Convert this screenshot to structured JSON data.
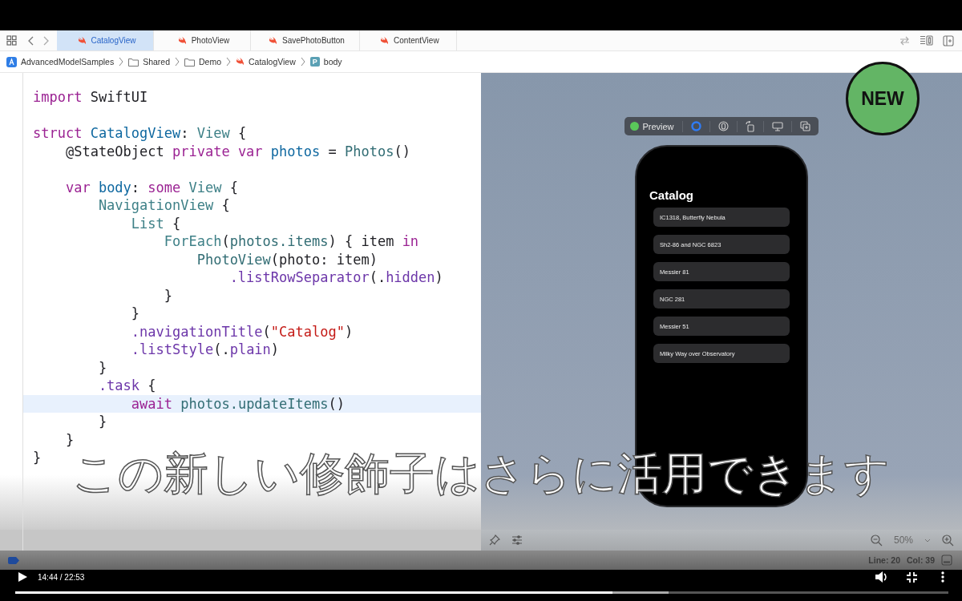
{
  "tabs": [
    {
      "label": "CatalogView",
      "selected": true
    },
    {
      "label": "PhotoView",
      "selected": false
    },
    {
      "label": "SavePhotoButton",
      "selected": false
    },
    {
      "label": "ContentView",
      "selected": false
    }
  ],
  "breadcrumb": [
    {
      "kind": "app",
      "label": "AdvancedModelSamples"
    },
    {
      "kind": "folder",
      "label": "Shared"
    },
    {
      "kind": "folder",
      "label": "Demo"
    },
    {
      "kind": "swift",
      "label": "CatalogView"
    },
    {
      "kind": "property",
      "badge": "P",
      "label": "body"
    }
  ],
  "code_lines": [
    {
      "kind": "code",
      "current": false,
      "tokens": [
        {
          "text": "import ",
          "kind": "kw"
        },
        {
          "text": "SwiftUI",
          "kind": "plain"
        }
      ]
    },
    {
      "kind": "blank"
    },
    {
      "kind": "code",
      "current": false,
      "tokens": [
        {
          "text": "struct ",
          "kind": "kw"
        },
        {
          "text": "CatalogView",
          "kind": "decl"
        },
        {
          "text": ": ",
          "kind": "plain"
        },
        {
          "text": "View",
          "kind": "type"
        },
        {
          "text": " {",
          "kind": "plain"
        }
      ]
    },
    {
      "kind": "code",
      "current": false,
      "tokens": [
        {
          "text": "    @StateObject ",
          "kind": "plain"
        },
        {
          "text": "private var ",
          "kind": "kw"
        },
        {
          "text": "photos",
          "kind": "decl"
        },
        {
          "text": " = ",
          "kind": "plain"
        },
        {
          "text": "Photos",
          "kind": "proj"
        },
        {
          "text": "()",
          "kind": "plain"
        }
      ]
    },
    {
      "kind": "blank"
    },
    {
      "kind": "code",
      "current": false,
      "tokens": [
        {
          "text": "    var ",
          "kind": "kw"
        },
        {
          "text": "body",
          "kind": "decl"
        },
        {
          "text": ": ",
          "kind": "plain"
        },
        {
          "text": "some ",
          "kind": "kw"
        },
        {
          "text": "View",
          "kind": "type"
        },
        {
          "text": " {",
          "kind": "plain"
        }
      ]
    },
    {
      "kind": "code",
      "current": false,
      "tokens": [
        {
          "text": "        NavigationView",
          "kind": "type"
        },
        {
          "text": " {",
          "kind": "plain"
        }
      ]
    },
    {
      "kind": "code",
      "current": false,
      "tokens": [
        {
          "text": "            List",
          "kind": "type"
        },
        {
          "text": " {",
          "kind": "plain"
        }
      ]
    },
    {
      "kind": "code",
      "current": false,
      "tokens": [
        {
          "text": "                ForEach",
          "kind": "type"
        },
        {
          "text": "(",
          "kind": "plain"
        },
        {
          "text": "photos.",
          "kind": "proj"
        },
        {
          "text": "items",
          "kind": "proj"
        },
        {
          "text": ") { item ",
          "kind": "plain"
        },
        {
          "text": "in",
          "kind": "kw"
        }
      ]
    },
    {
      "kind": "code",
      "current": false,
      "tokens": [
        {
          "text": "                    PhotoView",
          "kind": "proj"
        },
        {
          "text": "(photo: item)",
          "kind": "plain"
        }
      ]
    },
    {
      "kind": "code",
      "current": false,
      "tokens": [
        {
          "text": "                        .listRowSeparator",
          "kind": "member"
        },
        {
          "text": "(.",
          "kind": "plain"
        },
        {
          "text": "hidden",
          "kind": "member"
        },
        {
          "text": ")",
          "kind": "plain"
        }
      ]
    },
    {
      "kind": "code",
      "current": false,
      "tokens": [
        {
          "text": "                }",
          "kind": "plain"
        }
      ]
    },
    {
      "kind": "code",
      "current": false,
      "tokens": [
        {
          "text": "            }",
          "kind": "plain"
        }
      ]
    },
    {
      "kind": "code",
      "current": false,
      "tokens": [
        {
          "text": "            .navigationTitle",
          "kind": "member"
        },
        {
          "text": "(",
          "kind": "plain"
        },
        {
          "text": "\"Catalog\"",
          "kind": "string"
        },
        {
          "text": ")",
          "kind": "plain"
        }
      ]
    },
    {
      "kind": "code",
      "current": false,
      "tokens": [
        {
          "text": "            .listStyle",
          "kind": "member"
        },
        {
          "text": "(.",
          "kind": "plain"
        },
        {
          "text": "plain",
          "kind": "member"
        },
        {
          "text": ")",
          "kind": "plain"
        }
      ]
    },
    {
      "kind": "code",
      "current": false,
      "tokens": [
        {
          "text": "        }",
          "kind": "plain"
        }
      ]
    },
    {
      "kind": "code",
      "current": false,
      "tokens": [
        {
          "text": "        .task",
          "kind": "member"
        },
        {
          "text": " {",
          "kind": "plain"
        }
      ]
    },
    {
      "kind": "code",
      "current": true,
      "tokens": [
        {
          "text": "            await ",
          "kind": "kw"
        },
        {
          "text": "photos.",
          "kind": "proj"
        },
        {
          "text": "updateItems",
          "kind": "proj"
        },
        {
          "text": "()",
          "kind": "plain"
        }
      ]
    },
    {
      "kind": "code",
      "current": false,
      "tokens": [
        {
          "text": "        }",
          "kind": "plain"
        }
      ]
    },
    {
      "kind": "code",
      "current": false,
      "tokens": [
        {
          "text": "    }",
          "kind": "plain"
        }
      ]
    },
    {
      "kind": "code",
      "current": false,
      "tokens": [
        {
          "text": "}",
          "kind": "plain"
        }
      ]
    }
  ],
  "preview": {
    "label": "Preview",
    "live": true,
    "modes": [
      {
        "kind": "live",
        "selected": true
      },
      {
        "kind": "selectable",
        "selected": false
      },
      {
        "kind": "rotate",
        "selected": false
      },
      {
        "kind": "device",
        "selected": false
      },
      {
        "kind": "duplicate",
        "selected": false
      }
    ],
    "screen_title": "Catalog",
    "rows": [
      "IC1318, Butterfly Nebula",
      "Sh2-86 and NGC 6823",
      "Messier 81",
      "NGC 281",
      "Messier 51",
      "Milky Way over Observatory"
    ],
    "zoom": "50%"
  },
  "badge": "NEW",
  "subtitle": "この新しい修飾子はさらに活用できます",
  "status_bar": {
    "line": "Line: 20",
    "col": "Col: 39"
  },
  "video": {
    "time": "14:44 / 22:53",
    "progress": {
      "level": 0.64
    },
    "buffered": {
      "level": 0.7
    }
  }
}
